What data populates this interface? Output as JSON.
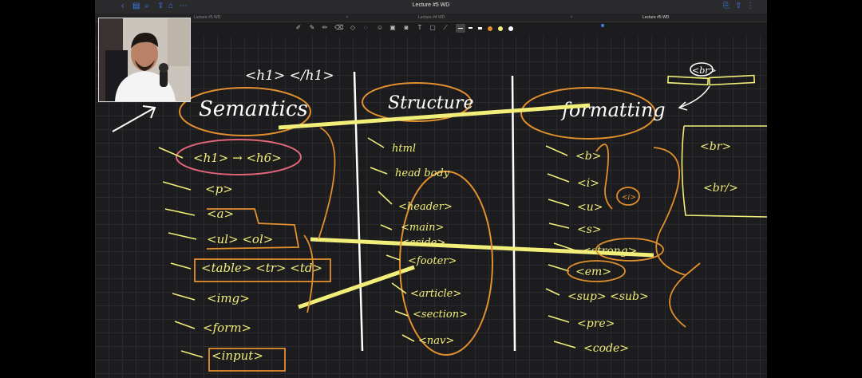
{
  "document": {
    "title": "Lecture #5 WD",
    "tabs": [
      {
        "label": "Lecture #5 WD",
        "active": false
      },
      {
        "label": "Lecture #4 WD",
        "active": false
      },
      {
        "label": "Lecture #5 WD",
        "active": true
      }
    ]
  },
  "toolbar": {
    "tools": [
      "lasso-icon",
      "pen-icon",
      "highlighter-icon",
      "eraser-icon",
      "shapes-icon",
      "lasso-select-icon",
      "smiley-icon",
      "image-icon",
      "camera-icon",
      "text-icon",
      "sticky-icon",
      "pointer-icon"
    ],
    "colors": [
      "#ffffff",
      "#ffffff",
      "#e28f2e",
      "#f1ee7a",
      "#ffffff",
      "#3d7ef5"
    ]
  },
  "canvas": {
    "columns": {
      "semantics": "Semantics",
      "structure": "Structure",
      "formatting": "formatting"
    },
    "top_note": "<h1>  </h1>",
    "semantics_items": [
      "<h1> → <h6>",
      "<p>",
      "<a>",
      "<ul>  <ol>",
      "<table>  <tr>  <td>",
      "<img>",
      "<form>",
      "<input>"
    ],
    "structure_items": [
      "html",
      "head  body",
      "<header>",
      "<main>",
      "<aside>",
      "<footer>",
      "<article>",
      "<section>",
      "<nav>"
    ],
    "formatting_items": [
      "<b>",
      "<i>",
      "<u>",
      "<s>",
      "<strong>",
      "<em>",
      "<sup>  <sub>",
      "<pre>",
      "<code>"
    ],
    "side_notes": {
      "br_tag": "<br>",
      "br_box_1": "<br>",
      "br_box_2": "<br/>",
      "circled": "<i>"
    }
  }
}
